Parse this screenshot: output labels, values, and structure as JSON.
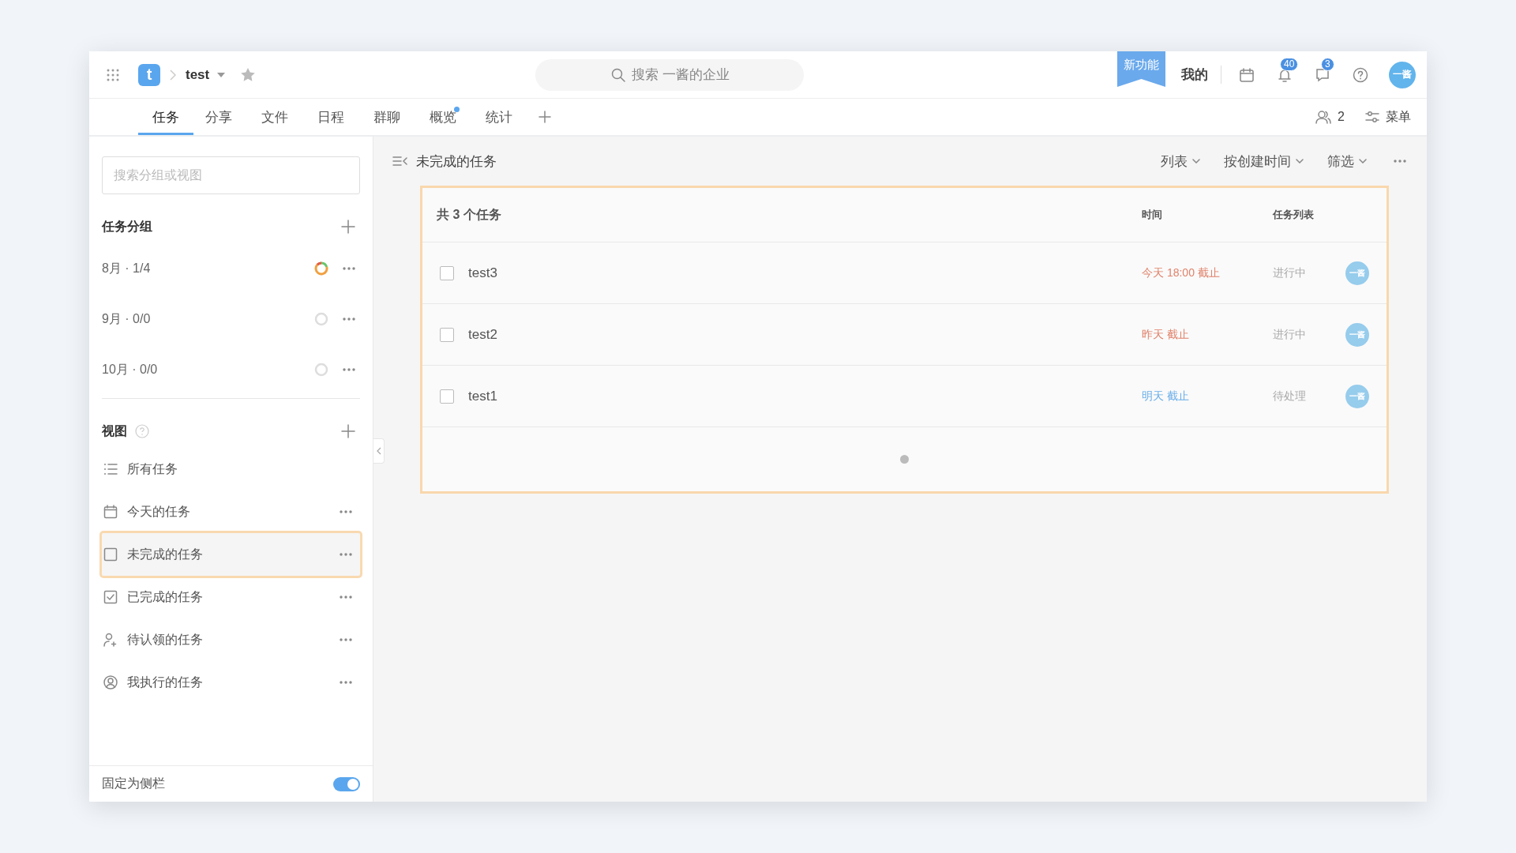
{
  "topbar": {
    "app_letter": "t",
    "project": "test",
    "search": {
      "placeholder": "搜索 一酱的企业"
    },
    "new_feature": "新功能",
    "mine": "我的",
    "notifications_badge": "40",
    "messages_badge": "3",
    "avatar": "一酱"
  },
  "tabs": [
    {
      "label": "任务",
      "selected": true,
      "dot": false
    },
    {
      "label": "分享",
      "selected": false,
      "dot": false
    },
    {
      "label": "文件",
      "selected": false,
      "dot": false
    },
    {
      "label": "日程",
      "selected": false,
      "dot": false
    },
    {
      "label": "群聊",
      "selected": false,
      "dot": false
    },
    {
      "label": "概览",
      "selected": false,
      "dot": true
    },
    {
      "label": "统计",
      "selected": false,
      "dot": false
    }
  ],
  "tab_tools": {
    "members": "2",
    "menu": "菜单"
  },
  "sidebar": {
    "search": {
      "placeholder": "搜索分组或视图"
    },
    "groups_title": "任务分组",
    "groups": [
      {
        "label": "8月 · 1/4",
        "has_tasks": true
      },
      {
        "label": "9月 · 0/0",
        "has_tasks": false
      },
      {
        "label": "10月 · 0/0",
        "has_tasks": false
      }
    ],
    "views_title": "视图",
    "views": [
      {
        "kind": "list",
        "label": "所有任务",
        "selected": false,
        "more": false
      },
      {
        "kind": "calendar",
        "label": "今天的任务",
        "selected": false,
        "more": true
      },
      {
        "kind": "open",
        "label": "未完成的任务",
        "selected": true,
        "more": true
      },
      {
        "kind": "done",
        "label": "已完成的任务",
        "selected": false,
        "more": true
      },
      {
        "kind": "claim",
        "label": "待认领的任务",
        "selected": false,
        "more": true
      },
      {
        "kind": "mine",
        "label": "我执行的任务",
        "selected": false,
        "more": true
      }
    ],
    "pin": {
      "label": "固定为侧栏",
      "on": true
    }
  },
  "main": {
    "title": "未完成的任务",
    "controls": [
      "列表",
      "按创建时间",
      "筛选"
    ],
    "table": {
      "columns": [
        "共 3 个任务",
        "时间",
        "任务列表"
      ],
      "rows": [
        {
          "checked": false,
          "name": "test3",
          "due": {
            "text": "今天 18:00 截止",
            "color": "#e0826a"
          },
          "list": "进行中",
          "assignee": "一酱"
        },
        {
          "checked": false,
          "name": "test2",
          "due": {
            "text": "昨天 截止",
            "color": "#e0826a"
          },
          "list": "进行中",
          "assignee": "一酱"
        },
        {
          "checked": false,
          "name": "test1",
          "due": {
            "text": "明天 截止",
            "color": "#6aaee8"
          },
          "list": "待处理",
          "assignee": "一酱"
        }
      ]
    }
  }
}
